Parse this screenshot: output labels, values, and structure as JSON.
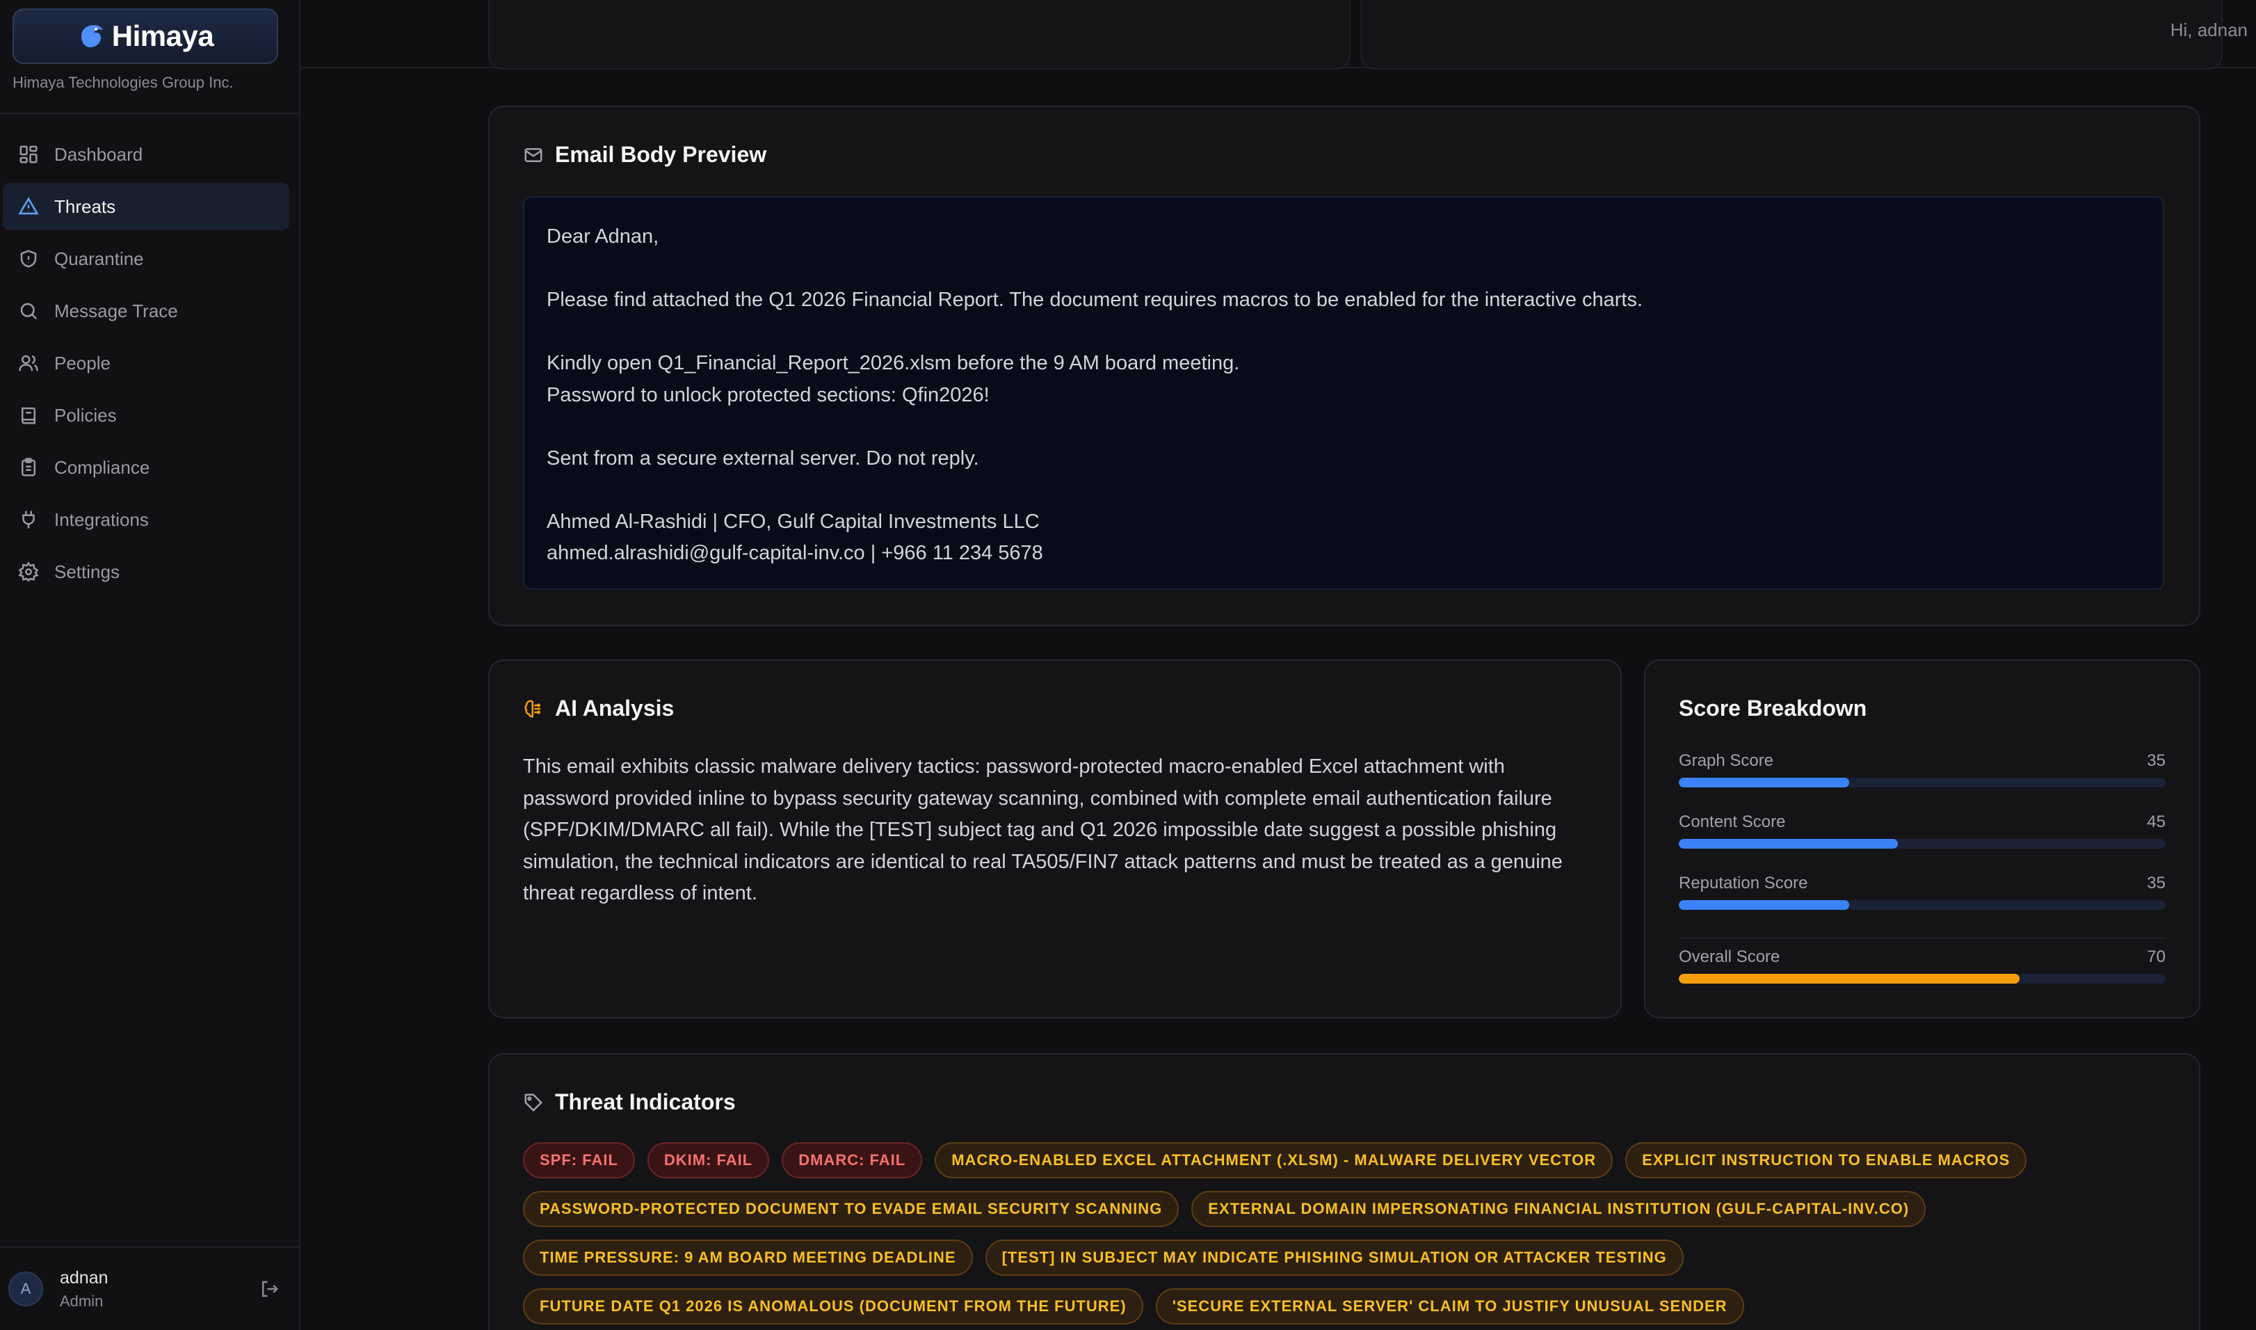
{
  "brand": {
    "logo_text": "Himaya",
    "org_name": "Himaya Technologies Group Inc."
  },
  "nav": {
    "items": [
      {
        "label": "Dashboard",
        "icon": "grid-icon"
      },
      {
        "label": "Threats",
        "icon": "alert-triangle-icon",
        "active": true
      },
      {
        "label": "Quarantine",
        "icon": "shield-icon"
      },
      {
        "label": "Message Trace",
        "icon": "search-icon"
      },
      {
        "label": "People",
        "icon": "users-icon"
      },
      {
        "label": "Policies",
        "icon": "book-icon"
      },
      {
        "label": "Compliance",
        "icon": "clipboard-icon"
      },
      {
        "label": "Integrations",
        "icon": "plug-icon"
      },
      {
        "label": "Settings",
        "icon": "gear-icon"
      }
    ]
  },
  "user": {
    "avatar_initial": "A",
    "name": "adnan",
    "role": "Admin"
  },
  "header": {
    "greeting": "Hi, adnan"
  },
  "email_preview": {
    "title": "Email Body Preview",
    "lines": [
      "Dear Adnan,",
      "",
      "Please find attached the Q1 2026 Financial Report. The document requires macros to be enabled for the interactive charts.",
      "",
      "Kindly open Q1_Financial_Report_2026.xlsm before the 9 AM board meeting.",
      "Password to unlock protected sections: Qfin2026!",
      "",
      "Sent from a secure external server. Do not reply.",
      "",
      "Ahmed Al-Rashidi | CFO, Gulf Capital Investments LLC",
      "ahmed.alrashidi@gulf-capital-inv.co | +966 11 234 5678"
    ]
  },
  "ai_analysis": {
    "title": "AI Analysis",
    "text": "This email exhibits classic malware delivery tactics: password-protected macro-enabled Excel attachment with password provided inline to bypass security gateway scanning, combined with complete email authentication failure (SPF/DKIM/DMARC all fail). While the [TEST] subject tag and Q1 2026 impossible date suggest a possible phishing simulation, the technical indicators are identical to real TA505/FIN7 attack patterns and must be treated as a genuine threat regardless of intent."
  },
  "score_breakdown": {
    "title": "Score Breakdown",
    "max": 100,
    "scores": [
      {
        "label": "Graph Score",
        "value": 35
      },
      {
        "label": "Content Score",
        "value": 45
      },
      {
        "label": "Reputation Score",
        "value": 35
      }
    ],
    "overall": {
      "label": "Overall Score",
      "value": 70
    },
    "colors": {
      "bar": "#3b82f6",
      "overall": "#f59e0b",
      "track": "#1b2235"
    }
  },
  "threat_indicators": {
    "title": "Threat Indicators",
    "tags": [
      {
        "text": "SPF: FAIL",
        "severity": "red"
      },
      {
        "text": "DKIM: FAIL",
        "severity": "red"
      },
      {
        "text": "DMARC: FAIL",
        "severity": "red"
      },
      {
        "text": "Macro-enabled Excel attachment (.xlsm) - malware delivery vector",
        "severity": "amber"
      },
      {
        "text": "Explicit instruction to enable macros",
        "severity": "amber"
      },
      {
        "text": "Password-protected document to evade email security scanning",
        "severity": "amber"
      },
      {
        "text": "External domain impersonating financial institution (gulf-capital-inv.co)",
        "severity": "amber"
      },
      {
        "text": "Time pressure: 9 AM board meeting deadline",
        "severity": "amber"
      },
      {
        "text": "[TEST] in subject may indicate phishing simulation or attacker testing",
        "severity": "amber"
      },
      {
        "text": "Future date Q1 2026 is anomalous (document from the future)",
        "severity": "amber"
      },
      {
        "text": "'Secure external server' claim to justify unusual sender",
        "severity": "amber"
      }
    ]
  }
}
